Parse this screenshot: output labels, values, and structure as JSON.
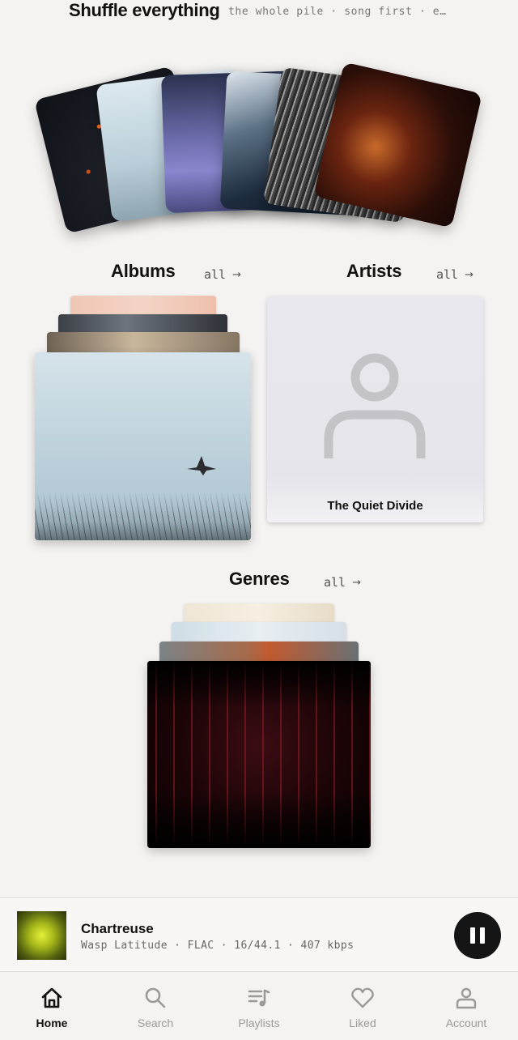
{
  "shuffle": {
    "title": "Shuffle everything",
    "subtitle": "the whole pile · song first · e…"
  },
  "albums": {
    "title": "Albums",
    "all_label": "all"
  },
  "artists": {
    "title": "Artists",
    "all_label": "all",
    "featured_name": "The Quiet Divide"
  },
  "genres": {
    "title": "Genres",
    "all_label": "all"
  },
  "now_playing": {
    "title": "Chartreuse",
    "meta": "Wasp Latitude · FLAC · 16/44.1 · 407 kbps"
  },
  "nav": {
    "items": [
      {
        "label": "Home",
        "icon": "home-icon",
        "active": true
      },
      {
        "label": "Search",
        "icon": "search-icon",
        "active": false
      },
      {
        "label": "Playlists",
        "icon": "playlist-icon",
        "active": false
      },
      {
        "label": "Liked",
        "icon": "heart-icon",
        "active": false
      },
      {
        "label": "Account",
        "icon": "person-icon",
        "active": false
      }
    ]
  }
}
